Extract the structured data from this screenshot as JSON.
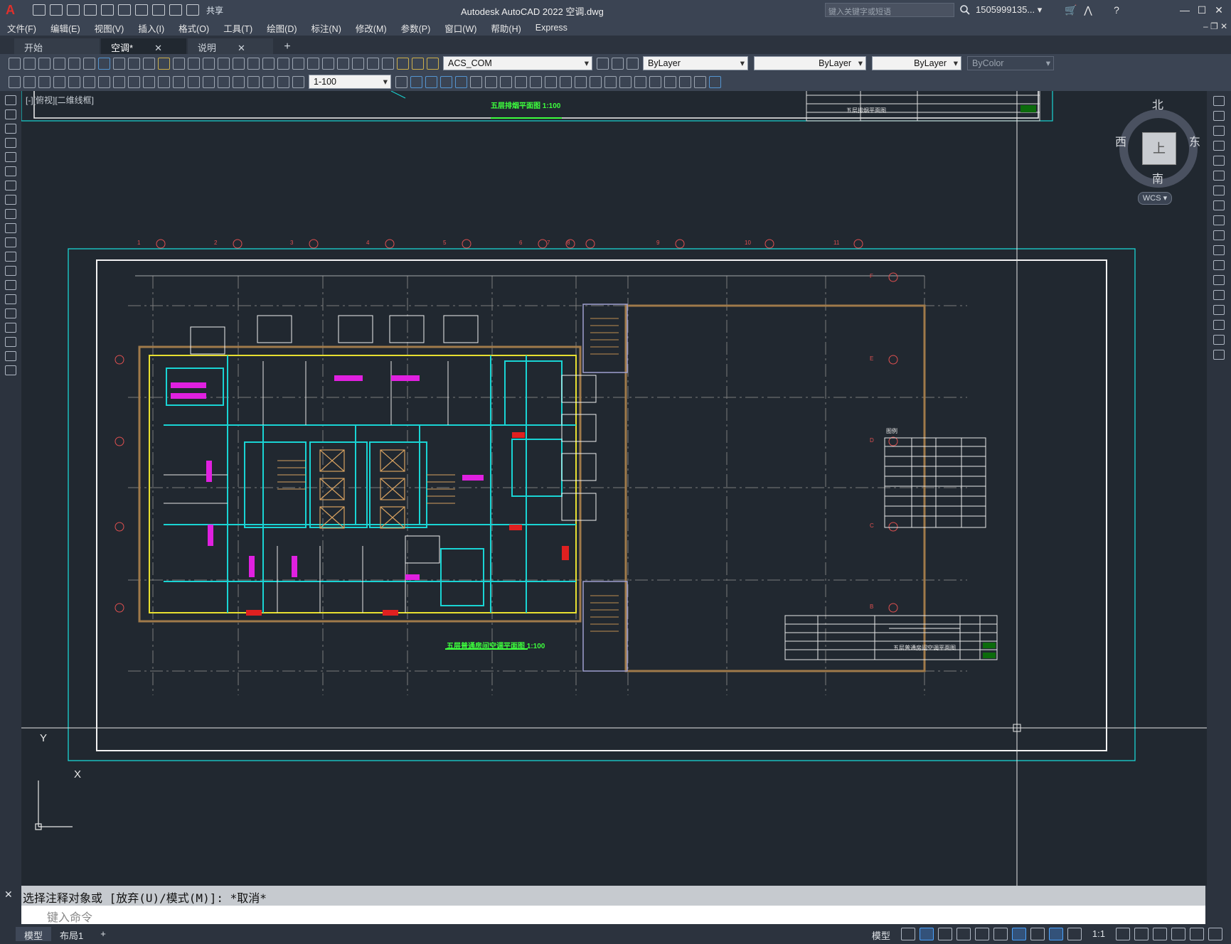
{
  "app": {
    "title": "Autodesk AutoCAD 2022    空调.dwg",
    "share_label": "共享",
    "search_placeholder": "键入关键字或短语",
    "user": "1505999135... ▾"
  },
  "menu": [
    "文件(F)",
    "编辑(E)",
    "视图(V)",
    "插入(I)",
    "格式(O)",
    "工具(T)",
    "绘图(D)",
    "标注(N)",
    "修改(M)",
    "参数(P)",
    "窗口(W)",
    "帮助(H)",
    "Express"
  ],
  "tabs": [
    {
      "label": "开始",
      "closable": false
    },
    {
      "label": "空调*",
      "closable": true,
      "active": true
    },
    {
      "label": "说明",
      "closable": true
    }
  ],
  "toolbar": {
    "ucs_combo": "ACS_COM",
    "layer_color": "ByLayer",
    "linetype": "ByLayer",
    "lineweight": "ByLayer",
    "plot_style": "ByColor",
    "scale_combo": "1-100"
  },
  "viewport": {
    "label": "[-][俯视][二维线框]",
    "top_drawing_title": "五层排烟平面图",
    "top_drawing_scale": "1:100",
    "main_drawing_title": "五层普通房间空调平面图",
    "main_drawing_scale": "1:100",
    "grid_numbers": [
      "1",
      "2",
      "3",
      "4",
      "5",
      "6",
      "7",
      "8",
      "9",
      "10",
      "11"
    ],
    "grid_letters": [
      "F",
      "E",
      "D",
      "C",
      "B"
    ],
    "title_block_name": "五层普通房间空调平面图",
    "top_title_block_name": "五层排烟平面图",
    "legend_title": "图例"
  },
  "viewcube": {
    "north": "北",
    "south": "南",
    "east": "东",
    "west": "西",
    "face": "上",
    "wcs": "WCS ▾"
  },
  "ucs_icon": {
    "x": "X",
    "y": "Y"
  },
  "command": {
    "history": "选择注释对象或 [放弃(U)/模式(M)]: *取消*",
    "input_placeholder": "键入命令"
  },
  "status": {
    "tabs": [
      {
        "label": "模型",
        "active": true
      },
      {
        "label": "布局1",
        "active": false
      }
    ],
    "model_label": "模型",
    "annotation_scale": "1:1"
  }
}
